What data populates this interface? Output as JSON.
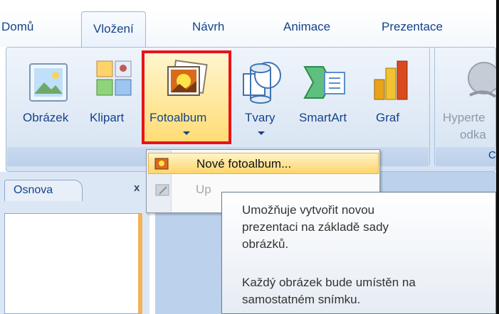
{
  "tabs": {
    "home": "Domů",
    "insert": "Vložení",
    "design": "Návrh",
    "animations": "Animace",
    "presentation": "Prezentace"
  },
  "ribbon": {
    "picture": "Obrázek",
    "clipart": "Klipart",
    "photo_album": "Fotoalbum",
    "shapes": "Tvary",
    "smartart": "SmartArt",
    "chart": "Graf",
    "hyperlink_line1": "Hyperte",
    "hyperlink_line2": "odka",
    "group_tail": "C"
  },
  "dropdown": {
    "new_album": "Nové fotoalbum...",
    "edit_album": "Up"
  },
  "panel": {
    "outline_tab": "Osnova",
    "close": "x"
  },
  "tooltip": {
    "line1": "Umožňuje vytvořit novou",
    "line2": "prezentaci na základě sady",
    "line3": "obrázků.",
    "line4": "Každý obrázek bude umístěn na",
    "line5": "samostatném snímku."
  },
  "colors": {
    "highlight_border": "#e8131b",
    "ribbon_text": "#15428b",
    "menu_hover": "#ffd56a"
  }
}
